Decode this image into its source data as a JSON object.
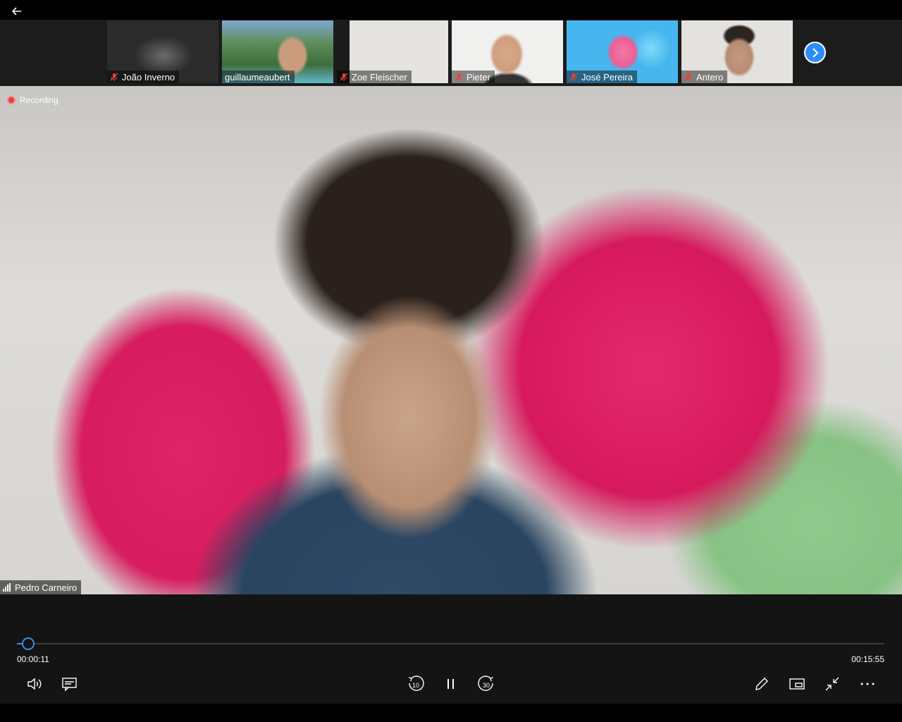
{
  "participants": [
    {
      "name": "João Inverno",
      "muted": true
    },
    {
      "name": "guillaumeaubert",
      "muted": false
    },
    {
      "name": "Zoe Fleischer",
      "muted": true
    },
    {
      "name": "Pieter",
      "muted": true
    },
    {
      "name": "José Pereira",
      "muted": true
    },
    {
      "name": "Antero",
      "muted": true
    }
  ],
  "main": {
    "recording_label": "Recording",
    "speaker_name": "Pedro Carneiro"
  },
  "player": {
    "current_time": "00:00:11",
    "total_time": "00:15:55",
    "progress_fraction": 0.0115
  },
  "colors": {
    "accent": "#2d8cff",
    "recording": "#e8413c",
    "control_bg": "#141414"
  },
  "icons": {
    "back": "arrow-left-icon",
    "next": "chevron-right-icon",
    "mic_off": "mic-muted-icon",
    "volume": "volume-icon",
    "captions": "captions-icon",
    "rewind": "rewind-10-icon",
    "pause": "pause-icon",
    "forward": "forward-30-icon",
    "pen": "pen-icon",
    "mini_player": "mini-player-icon",
    "exit_fullscreen": "exit-fullscreen-icon",
    "more": "more-icon"
  }
}
